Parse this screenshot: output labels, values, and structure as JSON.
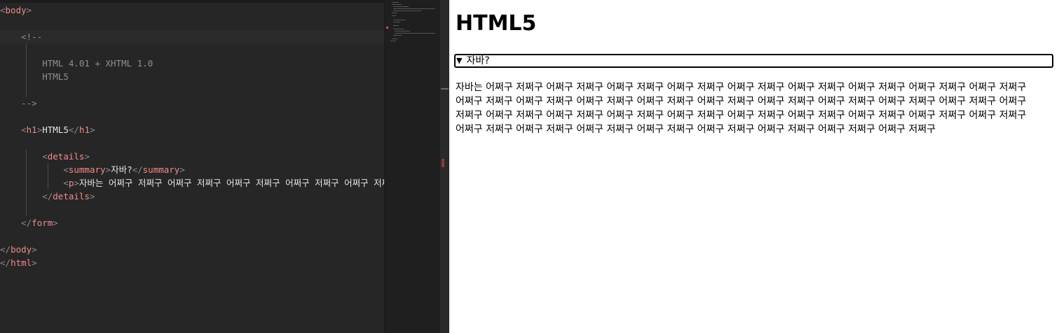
{
  "editor": {
    "lines": [
      {
        "indent": "",
        "parts": [
          [
            "punct",
            "<"
          ],
          [
            "tag",
            "body"
          ],
          [
            "punct",
            ">"
          ]
        ]
      },
      {
        "indent": "",
        "parts": []
      },
      {
        "indent": "    ",
        "parts": [
          [
            "comment",
            "<!--"
          ]
        ]
      },
      {
        "indent": "",
        "parts": []
      },
      {
        "indent": "        ",
        "parts": [
          [
            "comment",
            "HTML 4.01 + XHTML 1.0"
          ]
        ]
      },
      {
        "indent": "        ",
        "parts": [
          [
            "comment",
            "HTML5"
          ]
        ]
      },
      {
        "indent": "",
        "parts": []
      },
      {
        "indent": "    ",
        "parts": [
          [
            "comment",
            "-->"
          ]
        ]
      },
      {
        "indent": "",
        "parts": []
      },
      {
        "indent": "    ",
        "parts": [
          [
            "punct",
            "<"
          ],
          [
            "tag",
            "h1"
          ],
          [
            "punct",
            ">"
          ],
          [
            "txt",
            "HTML5"
          ],
          [
            "punct",
            "</"
          ],
          [
            "tag",
            "h1"
          ],
          [
            "punct",
            ">"
          ]
        ]
      },
      {
        "indent": "",
        "parts": []
      },
      {
        "indent": "        ",
        "parts": [
          [
            "punct",
            "<"
          ],
          [
            "tag",
            "details"
          ],
          [
            "punct",
            ">"
          ]
        ]
      },
      {
        "indent": "            ",
        "parts": [
          [
            "punct",
            "<"
          ],
          [
            "tag",
            "summary"
          ],
          [
            "punct",
            ">"
          ],
          [
            "txt",
            "자바?"
          ],
          [
            "punct",
            "</"
          ],
          [
            "tag",
            "summary"
          ],
          [
            "punct",
            ">"
          ]
        ]
      },
      {
        "indent": "            ",
        "parts": [
          [
            "punct",
            "<"
          ],
          [
            "tag",
            "p"
          ],
          [
            "punct",
            ">"
          ],
          [
            "txt",
            "자바는 어쩌구 저쩌구 어쩌구 저쩌구 어쩌구 저쩌구 어쩌구 저쩌구 어쩌구 저쩌구"
          ]
        ]
      },
      {
        "indent": "        ",
        "parts": [
          [
            "punct",
            "</"
          ],
          [
            "tag",
            "details"
          ],
          [
            "punct",
            ">"
          ]
        ]
      },
      {
        "indent": "",
        "parts": []
      },
      {
        "indent": "    ",
        "parts": [
          [
            "punct",
            "</"
          ],
          [
            "tag",
            "form"
          ],
          [
            "punct",
            ">"
          ]
        ]
      },
      {
        "indent": "",
        "parts": []
      },
      {
        "indent": "",
        "parts": [
          [
            "punct",
            "</"
          ],
          [
            "tag",
            "body"
          ],
          [
            "punct",
            ">"
          ]
        ]
      },
      {
        "indent": "",
        "parts": [
          [
            "punct",
            "</"
          ],
          [
            "tag",
            "html"
          ],
          [
            "punct",
            ">"
          ]
        ]
      }
    ]
  },
  "preview": {
    "heading": "HTML5",
    "summary_marker": "▼",
    "summary_text": "자바?",
    "paragraph": "자바는 어쩌구 저쩌구 어쩌구 저쩌구 어쩌구 저쩌구 어쩌구 저쩌구 어쩌구 저쩌구 어쩌구 저쩌구 어쩌구 저쩌구 어쩌구 저쩌구 어쩌구 저쩌구 어쩌구 저쩌구 어쩌구 저쩌구 어쩌구 저쩌구 어쩌구 저쩌구 어쩌구 저쩌구 어쩌구 저쩌구 어쩌구 저쩌구 어쩌구 저쩌구 어쩌구 저쩌구 어쩌구 저쩌구 어쩌구 저쩌구 어쩌구 저쩌구 어쩌구 저쩌구 어쩌구 저쩌구 어쩌구 저쩌구 어쩌구 저쩌구 어쩌구 저쩌구 어쩌구 저쩌구 어쩌구 저쩌구 어쩌구 저쩌구 어쩌구 저쩌구 어쩌구 저쩌구 어쩌구 저쩌구 어쩌구 저쩌구 어쩌구 저쩌구 어쩌구 저쩌구 어쩌구 저쩌구"
  },
  "colors": {
    "editor_bg": "#262626",
    "tag": "#f28b8b",
    "punct": "#8a8a8a",
    "comment": "#8f8f8f",
    "preview_bg": "#ffffff"
  }
}
